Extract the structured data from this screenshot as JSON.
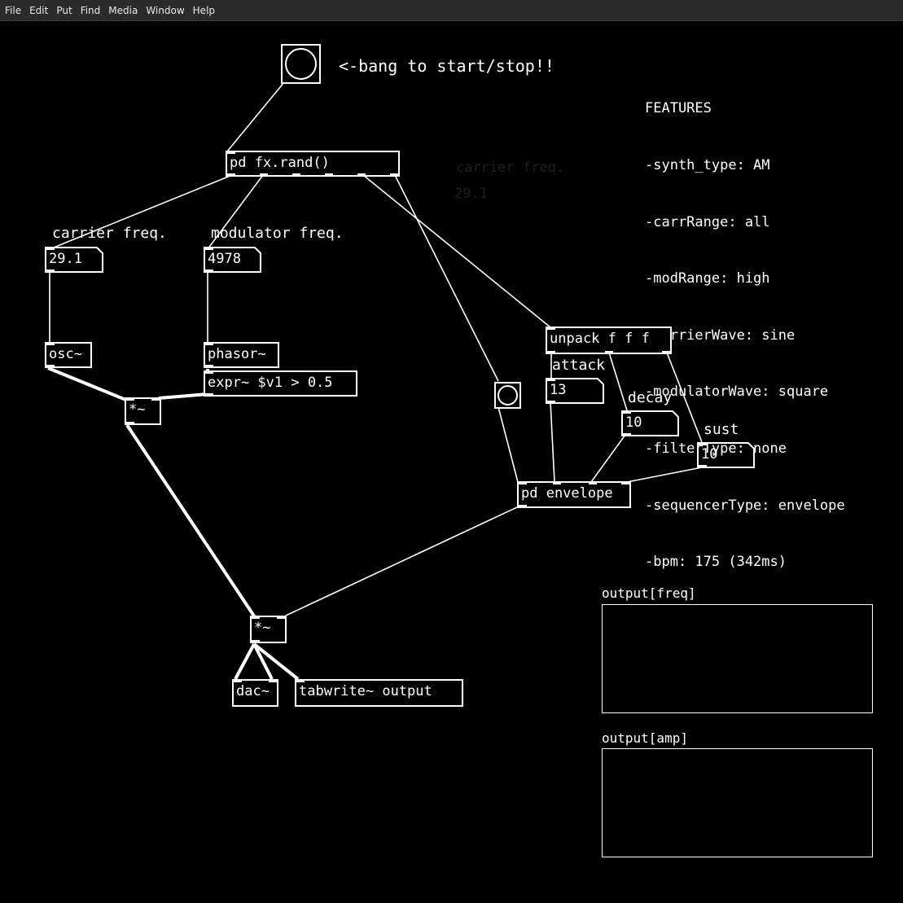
{
  "menu": [
    "File",
    "Edit",
    "Put",
    "Find",
    "Media",
    "Window",
    "Help"
  ],
  "bang_comment": "<-bang to start/stop!!",
  "features": {
    "title": "FEATURES",
    "lines": [
      "-synth_type: AM",
      "-carrRange: all",
      "-modRange: high",
      "-carrierWave: sine",
      "-modulatorWave: square",
      "-filterType: none",
      "-sequencerType: envelope",
      "-bpm: 175 (342ms)"
    ]
  },
  "objects": {
    "fx_rand": "pd   fx.rand()",
    "osc": "osc~",
    "phasor": "phasor~",
    "expr": "expr~ $v1 > 0.5",
    "mul1": "*~",
    "mul2": "*~",
    "dac": "dac~",
    "tabwrite": "tabwrite~ output",
    "unpack": "unpack f f f",
    "envelope": "pd envelope"
  },
  "number_boxes": {
    "carrier": {
      "label": "carrier freq.",
      "value": "29.1"
    },
    "modulator": {
      "label": "modulator freq.",
      "value": "4978"
    },
    "attack": {
      "label": "attack",
      "value": "13"
    },
    "decay": {
      "label": "decay",
      "value": "10"
    },
    "sustain": {
      "label": "sust",
      "value": "10"
    }
  },
  "arrays": {
    "freq": "output[freq]",
    "amp": "output[amp]"
  },
  "ghost": {
    "label": "carrier freq.",
    "value": "29.1"
  },
  "colors": {
    "background": "#000000",
    "foreground": "#ffffff",
    "menubar": "#2b2b2b"
  }
}
